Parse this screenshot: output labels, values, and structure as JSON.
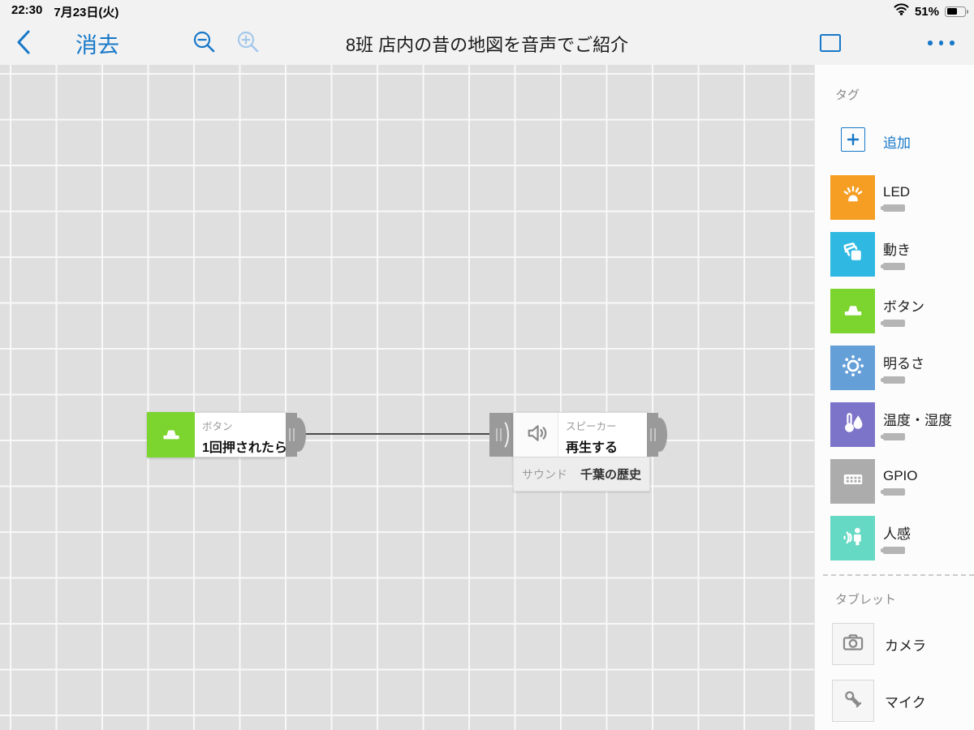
{
  "status_bar": {
    "time": "22:30",
    "date": "7月23日(火)",
    "battery_percent": "51%"
  },
  "nav": {
    "erase_label": "消去",
    "title": "8班 店内の昔の地図を音声でご紹介"
  },
  "icons": {
    "back": "chevron-left",
    "zoom_out": "magnifier-minus",
    "zoom_in": "magnifier-plus",
    "canvas_mode": "square-outline",
    "more": "ellipsis",
    "wifi": "wifi",
    "battery": "battery-half"
  },
  "colors": {
    "nav_blue": "#1778C8",
    "connector_gray": "#9A9A9A",
    "wire": "#4A4A4A"
  },
  "canvas": {
    "blocks": [
      {
        "type": "button",
        "tag_label": "ボタン",
        "action_label": "1回押されたら",
        "color": "#7CD42F"
      },
      {
        "type": "speaker",
        "tag_label": "スピーカー",
        "action_label": "再生する",
        "property_label": "サウンド",
        "property_value": "千葉の歴史"
      }
    ]
  },
  "sidebar": {
    "tags_header": "タグ",
    "add_label": "追加",
    "items": [
      {
        "label": "LED",
        "color": "#F59E23"
      },
      {
        "label": "動き",
        "color": "#2FB9E2"
      },
      {
        "label": "ボタン",
        "color": "#7CD42F"
      },
      {
        "label": "明るさ",
        "color": "#649FD8"
      },
      {
        "label": "温度・湿度",
        "color": "#7B74C8"
      },
      {
        "label": "GPIO",
        "color": "#ACACAC"
      },
      {
        "label": "人感",
        "color": "#66D9C4"
      }
    ],
    "tablet_header": "タブレット",
    "tablet_items": [
      {
        "label": "カメラ"
      },
      {
        "label": "マイク"
      }
    ]
  }
}
